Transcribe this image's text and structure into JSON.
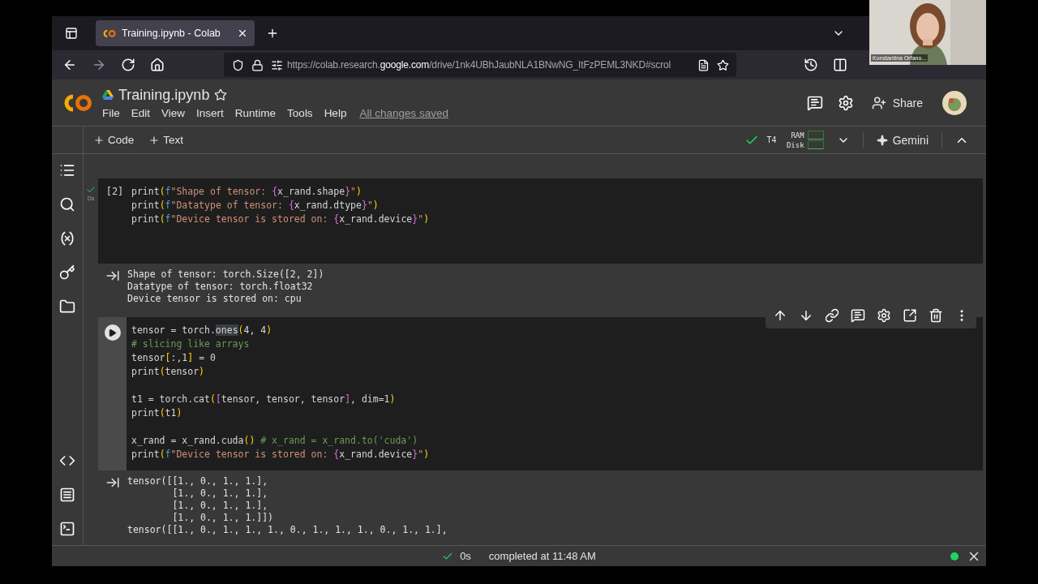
{
  "webcam": {
    "label": "Konstantina Orfano..."
  },
  "browser": {
    "tab": {
      "title": "Training.ipynb - Colab",
      "selected": true
    },
    "url_parts": [
      {
        "text": "https://colab.research.",
        "kind": "dim"
      },
      {
        "text": "google.com",
        "kind": "host"
      },
      {
        "text": "/drive/1nk4UBhJaubNLA1BNwNG_ItFzPEML3NKD#scrol",
        "kind": "dim"
      }
    ]
  },
  "notebook": {
    "title": "Training.ipynb",
    "starred": false,
    "menu": [
      "File",
      "Edit",
      "View",
      "Insert",
      "Runtime",
      "Tools",
      "Help"
    ],
    "save_status": "All changes saved",
    "share": "Share"
  },
  "toolbar": {
    "add_buttons": [
      "Code",
      "Text"
    ],
    "runtime": {
      "connected": true,
      "gpu": "T4",
      "ram_label": "RAM",
      "disk_label": "Disk"
    },
    "gemini": "Gemini"
  },
  "cells": [
    {
      "kind": "code",
      "selected": false,
      "executed": true,
      "exec_count": "[2]",
      "run_time": "0s",
      "lines": [
        {
          "kind": "code",
          "tokens": [
            {
              "kind": "plain",
              "text": "print"
            },
            {
              "kind": "paren",
              "text": "("
            },
            {
              "kind": "prefix",
              "text": "f"
            },
            {
              "kind": "string",
              "text": "\"Shape of tensor: "
            },
            {
              "kind": "brace",
              "text": "{"
            },
            {
              "kind": "plain",
              "text": "x_rand.shape"
            },
            {
              "kind": "brace",
              "text": "}"
            },
            {
              "kind": "string",
              "text": "\""
            },
            {
              "kind": "paren",
              "text": ")"
            }
          ]
        },
        {
          "kind": "code",
          "tokens": [
            {
              "kind": "plain",
              "text": "print"
            },
            {
              "kind": "paren",
              "text": "("
            },
            {
              "kind": "prefix",
              "text": "f"
            },
            {
              "kind": "string",
              "text": "\"Datatype of tensor: "
            },
            {
              "kind": "brace",
              "text": "{"
            },
            {
              "kind": "plain",
              "text": "x_rand.dtype"
            },
            {
              "kind": "brace",
              "text": "}"
            },
            {
              "kind": "string",
              "text": "\""
            },
            {
              "kind": "paren",
              "text": ")"
            }
          ]
        },
        {
          "kind": "code",
          "tokens": [
            {
              "kind": "plain",
              "text": "print"
            },
            {
              "kind": "paren",
              "text": "("
            },
            {
              "kind": "prefix",
              "text": "f"
            },
            {
              "kind": "string",
              "text": "\"Device tensor is stored on: "
            },
            {
              "kind": "brace",
              "text": "{"
            },
            {
              "kind": "plain",
              "text": "x_rand.device"
            },
            {
              "kind": "brace",
              "text": "}"
            },
            {
              "kind": "string",
              "text": "\""
            },
            {
              "kind": "paren",
              "text": ")"
            }
          ]
        }
      ],
      "output": [
        "Shape of tensor: torch.Size([2, 2])",
        "Datatype of tensor: torch.float32",
        "Device tensor is stored on: cpu"
      ]
    },
    {
      "kind": "code",
      "selected": true,
      "executed": false,
      "lines": [
        {
          "kind": "code",
          "tokens": [
            {
              "kind": "plain",
              "text": "tensor = torch."
            },
            {
              "kind": "match",
              "text": "ones"
            },
            {
              "kind": "paren",
              "text": "("
            },
            {
              "kind": "plain",
              "text": "4, 4"
            },
            {
              "kind": "paren",
              "text": ")"
            }
          ]
        },
        {
          "kind": "code",
          "tokens": [
            {
              "kind": "comment",
              "text": "# slicing like arrays"
            }
          ]
        },
        {
          "kind": "code",
          "tokens": [
            {
              "kind": "plain",
              "text": "tensor"
            },
            {
              "kind": "paren",
              "text": "["
            },
            {
              "kind": "plain",
              "text": ":,1"
            },
            {
              "kind": "paren",
              "text": "]"
            },
            {
              "kind": "plain",
              "text": " = 0"
            }
          ]
        },
        {
          "kind": "code",
          "tokens": [
            {
              "kind": "plain",
              "text": "print"
            },
            {
              "kind": "paren",
              "text": "("
            },
            {
              "kind": "plain",
              "text": "tensor"
            },
            {
              "kind": "paren",
              "text": ")"
            }
          ]
        },
        {
          "kind": "blank"
        },
        {
          "kind": "code",
          "tokens": [
            {
              "kind": "plain",
              "text": "t1 = torch.cat"
            },
            {
              "kind": "paren",
              "text": "("
            },
            {
              "kind": "brace",
              "text": "["
            },
            {
              "kind": "plain",
              "text": "tensor, tensor, tensor"
            },
            {
              "kind": "brace",
              "text": "]"
            },
            {
              "kind": "plain",
              "text": ", dim=1"
            },
            {
              "kind": "paren",
              "text": ")"
            }
          ]
        },
        {
          "kind": "code",
          "tokens": [
            {
              "kind": "plain",
              "text": "print"
            },
            {
              "kind": "paren",
              "text": "("
            },
            {
              "kind": "plain",
              "text": "t1"
            },
            {
              "kind": "paren",
              "text": ")"
            }
          ]
        },
        {
          "kind": "blank"
        },
        {
          "kind": "code",
          "tokens": [
            {
              "kind": "plain",
              "text": "x_rand = x_rand.cuda"
            },
            {
              "kind": "paren",
              "text": "()"
            },
            {
              "kind": "comment",
              "text": " # x_rand = x_rand.to('cuda')"
            }
          ]
        },
        {
          "kind": "code",
          "tokens": [
            {
              "kind": "plain",
              "text": "print"
            },
            {
              "kind": "paren",
              "text": "("
            },
            {
              "kind": "prefix",
              "text": "f"
            },
            {
              "kind": "string",
              "text": "\"Device tensor is stored on: "
            },
            {
              "kind": "brace",
              "text": "{"
            },
            {
              "kind": "plain",
              "text": "x_rand.device"
            },
            {
              "kind": "brace",
              "text": "}"
            },
            {
              "kind": "string",
              "text": "\""
            },
            {
              "kind": "paren",
              "text": ")"
            }
          ]
        }
      ],
      "output": [
        "tensor([[1., 0., 1., 1.],",
        "        [1., 0., 1., 1.],",
        "        [1., 0., 1., 1.],",
        "        [1., 0., 1., 1.]])",
        "tensor([[1., 0., 1., 1., 1., 0., 1., 1., 1., 0., 1., 1.],"
      ]
    }
  ],
  "status": {
    "connected": true,
    "time": "0s",
    "message": "completed at 11:48 AM"
  }
}
